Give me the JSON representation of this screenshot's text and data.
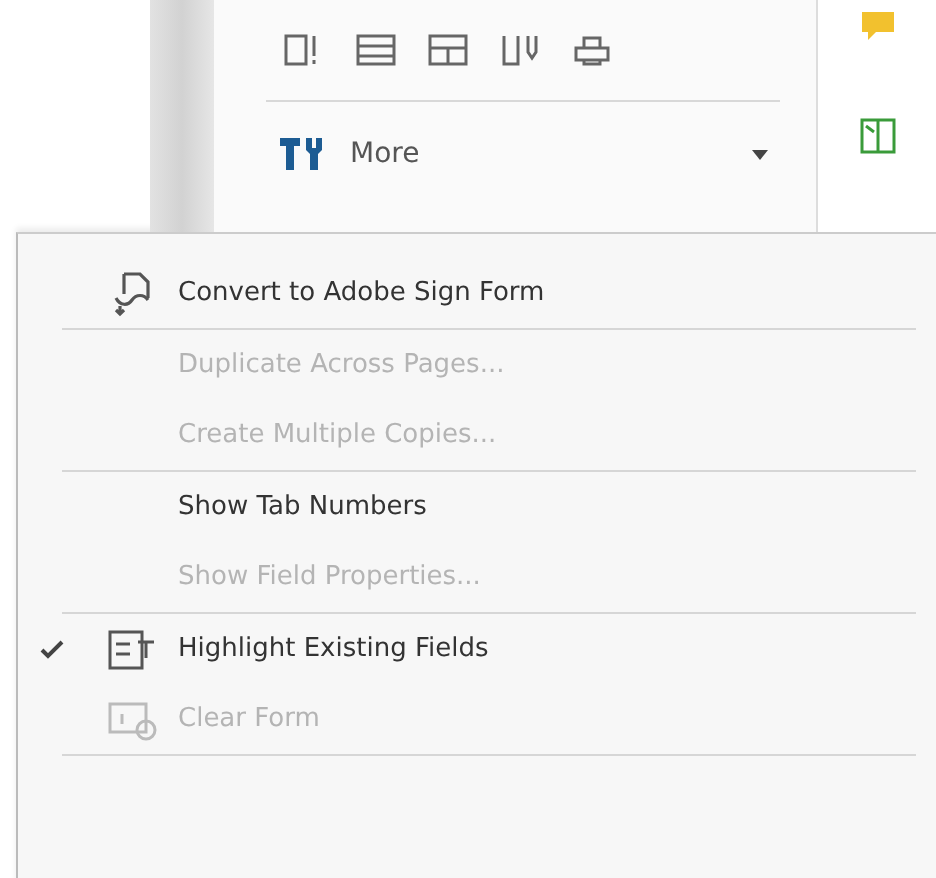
{
  "tool_panel": {
    "more_button": {
      "label": "More"
    }
  },
  "menu": [
    {
      "kind": "iconitem",
      "label": "Convert to Adobe Sign Form",
      "disabled": false,
      "checked": false
    },
    {
      "kind": "separator"
    },
    {
      "kind": "item",
      "label": "Duplicate Across Pages...",
      "disabled": true,
      "checked": false
    },
    {
      "kind": "item",
      "label": "Create Multiple Copies...",
      "disabled": true,
      "checked": false
    },
    {
      "kind": "separator"
    },
    {
      "kind": "item",
      "label": "Show Tab Numbers",
      "disabled": false,
      "checked": false
    },
    {
      "kind": "item",
      "label": "Show Field Properties...",
      "disabled": true,
      "checked": false
    },
    {
      "kind": "separator"
    },
    {
      "kind": "iconitem",
      "label": "Highlight Existing Fields",
      "disabled": false,
      "checked": true
    },
    {
      "kind": "iconitem",
      "label": "Clear Form",
      "disabled": true,
      "checked": false
    },
    {
      "kind": "separator"
    }
  ]
}
